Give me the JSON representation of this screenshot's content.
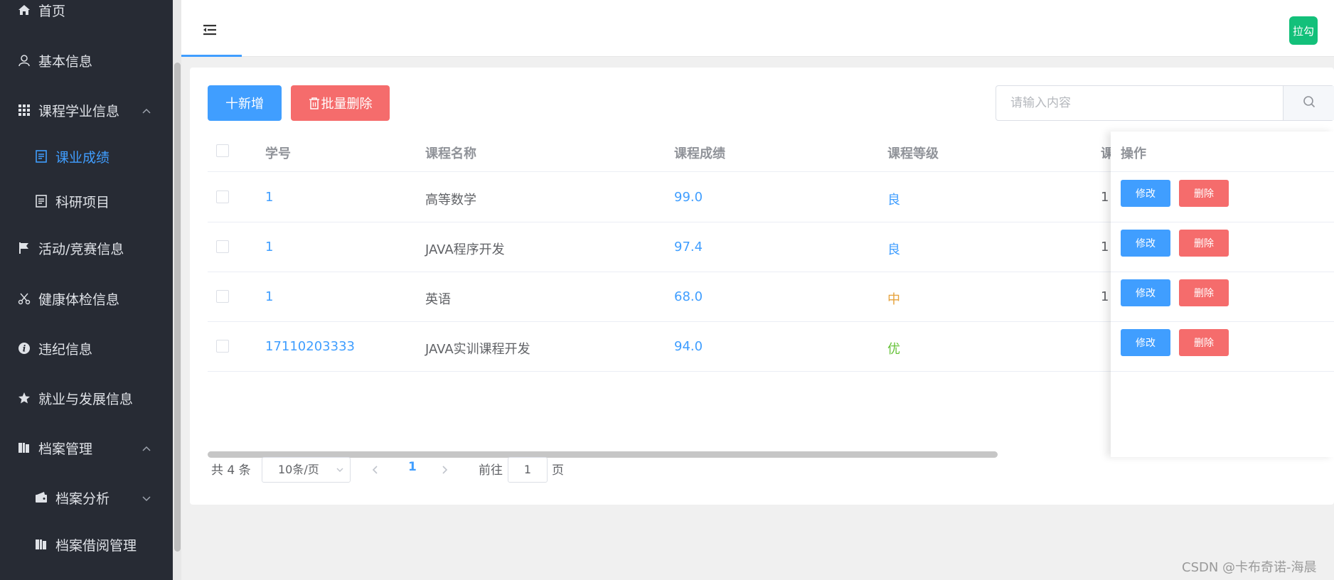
{
  "sidebar": {
    "items": [
      {
        "label": "首页",
        "icon": "home-icon"
      },
      {
        "label": "基本信息",
        "icon": "user-icon"
      },
      {
        "label": "课程学业信息",
        "icon": "grid-icon"
      },
      {
        "label": "课业成绩",
        "icon": "document-icon"
      },
      {
        "label": "科研项目",
        "icon": "document-icon"
      },
      {
        "label": "活动/竞赛信息",
        "icon": "flag-icon"
      },
      {
        "label": "健康体检信息",
        "icon": "scissors-icon"
      },
      {
        "label": "违纪信息",
        "icon": "info-icon"
      },
      {
        "label": "就业与发展信息",
        "icon": "star-icon"
      },
      {
        "label": "档案管理",
        "icon": "folder-icon"
      },
      {
        "label": "档案分析",
        "icon": "wallet-icon"
      },
      {
        "label": "档案借阅管理",
        "icon": "folder-icon"
      }
    ],
    "active_color": "#409eff",
    "background": "#272b34"
  },
  "header": {
    "avatar_text": "拉勾"
  },
  "toolbar": {
    "add_label": "十新增",
    "batch_delete_label": "批量删除",
    "search_placeholder": "请输入内容"
  },
  "table": {
    "columns": [
      "学号",
      "课程名称",
      "课程成绩",
      "课程等级",
      "课",
      "操作"
    ],
    "rows": [
      {
        "student_id": "1",
        "course": "高等数学",
        "score": "99.0",
        "grade": "良",
        "extra": "1"
      },
      {
        "student_id": "1",
        "course": "JAVA程序开发",
        "score": "97.4",
        "grade": "良",
        "extra": "1"
      },
      {
        "student_id": "1",
        "course": "英语",
        "score": "68.0",
        "grade": "中",
        "extra": "1"
      },
      {
        "student_id": "17110203333",
        "course": "JAVA实训课程开发",
        "score": "94.0",
        "grade": "优",
        "extra": ""
      }
    ],
    "edit_label": "修改",
    "delete_label": "删除"
  },
  "pagination": {
    "total": "共 4 条",
    "page_size": "10条/页",
    "current_page": "1",
    "goto_label": "前往",
    "goto_value": "1",
    "page_suffix": "页"
  },
  "watermark": "CSDN @卡布奇诺-海晨"
}
